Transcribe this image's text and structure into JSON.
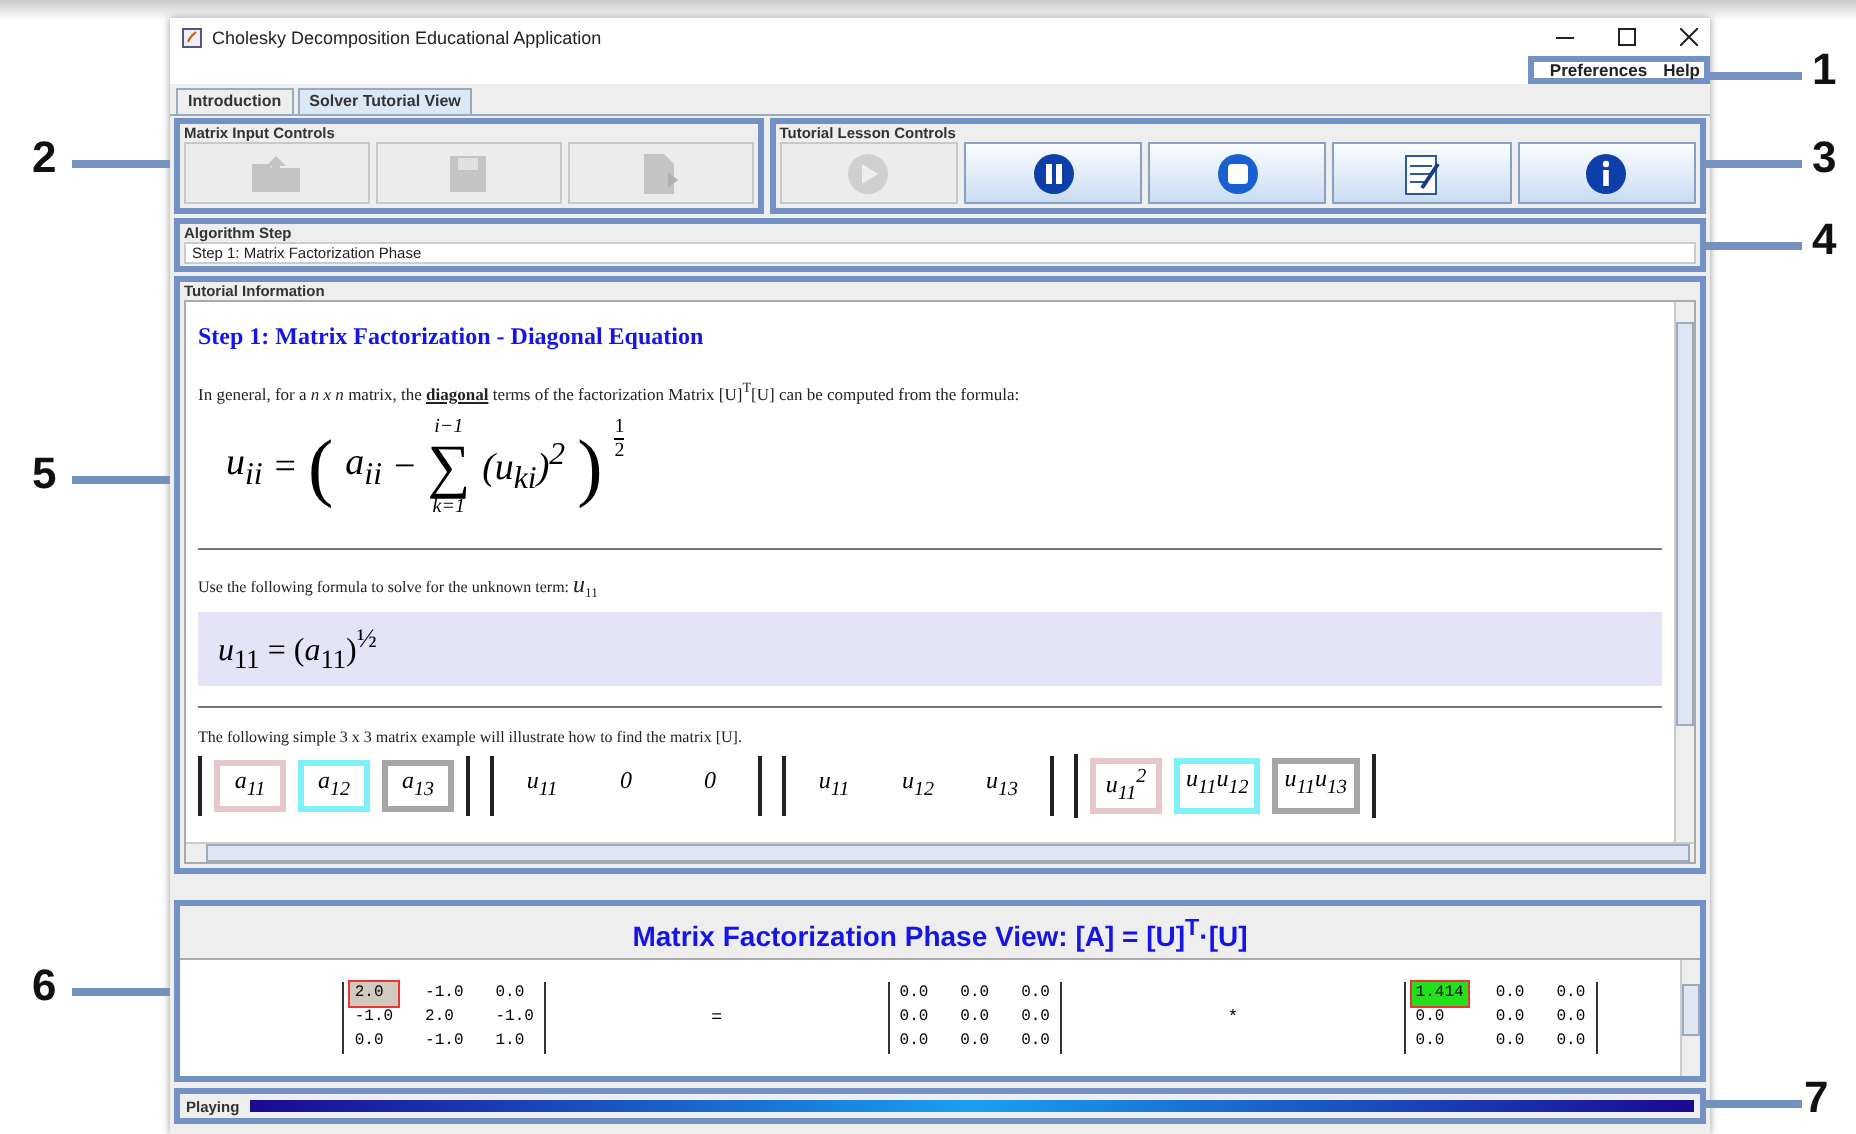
{
  "window": {
    "title": "Cholesky Decomposition Educational Application"
  },
  "menu": [
    {
      "label": "Preferences"
    },
    {
      "label": "Help"
    }
  ],
  "tabs": [
    {
      "label": "Introduction",
      "selected": false
    },
    {
      "label": "Solver Tutorial View",
      "selected": true
    }
  ],
  "matrix_input_controls": {
    "title": "Matrix Input Controls",
    "buttons": [
      {
        "kind": "open",
        "disabled": true
      },
      {
        "kind": "save",
        "disabled": true
      },
      {
        "kind": "export",
        "disabled": true
      }
    ]
  },
  "tutorial_lesson_controls": {
    "title": "Tutorial Lesson Controls",
    "buttons": [
      {
        "kind": "play",
        "disabled": true
      },
      {
        "kind": "pause",
        "disabled": false
      },
      {
        "kind": "stop",
        "disabled": false
      },
      {
        "kind": "notes",
        "disabled": false
      },
      {
        "kind": "info",
        "disabled": false
      }
    ]
  },
  "algorithm_step": {
    "title": "Algorithm Step",
    "value": "Step 1: Matrix Factorization Phase"
  },
  "tutorial": {
    "title": "Tutorial Information",
    "heading": "Step 1: Matrix Factorization - Diagonal Equation",
    "intro": "In general, for a *n x n* matrix, the **diagonal** terms of the factorization Matrix [U]$^{T}$[U] can be computed from the formula:",
    "formula": {
      "lhs": "u$_{ii}$",
      "eq": "=",
      "open": "(",
      "term": "a$_{ii}$",
      "minus": "−",
      "sum": "∑",
      "sum_upper": "i−1",
      "sum_lower": "k=1",
      "summand": "(u$_{ki}$)$^{2}$",
      "close": ")",
      "exp_num": "1",
      "exp_den": "2"
    },
    "prompt": "Use the following formula to solve for the unknown term: *u*$_{11}$",
    "formula2": "*u*$_{11}$ = (*a*$_{11}$)$^{½}$",
    "example": "The following simple 3 x 3 matrix example will illustrate how to find the matrix [U].",
    "example_matrices": [
      {
        "cells": [
          {
            "text": "a$_{11}$",
            "color": "#e6c8cc"
          },
          {
            "text": "a$_{12}$",
            "color": "#7ff0f8"
          },
          {
            "text": "a$_{13}$",
            "color": "#a6a6a6"
          }
        ]
      },
      {
        "cells": [
          {
            "text": "u$_{11}$"
          },
          {
            "text": "0"
          },
          {
            "text": "0"
          }
        ]
      },
      {
        "cells": [
          {
            "text": "u$_{11}$"
          },
          {
            "text": "u$_{12}$"
          },
          {
            "text": "u$_{13}$"
          }
        ]
      },
      {
        "cells": [
          {
            "text": "u$_{11}$$^{2}$",
            "color": "#e6c8cc"
          },
          {
            "text": "u$_{11}$u$_{12}$",
            "color": "#7ff0f8"
          },
          {
            "text": "u$_{11}$u$_{13}$",
            "color": "#a6a6a6"
          }
        ]
      }
    ]
  },
  "phase_view": {
    "title": "Matrix Factorization Phase View: [A] = [U]$^{T}$·[U]",
    "items": [
      {
        "kind": "matrix",
        "rows": [
          [
            {
              "text": "2.0",
              "color": "#cfcabd"
            },
            "-1.0",
            "0.0"
          ],
          [
            "-1.0",
            "2.0",
            "-1.0"
          ],
          [
            "0.0",
            "-1.0",
            "1.0"
          ]
        ]
      },
      {
        "kind": "operator",
        "text": "="
      },
      {
        "kind": "matrix",
        "rows": [
          [
            "0.0",
            "0.0",
            "0.0"
          ],
          [
            "0.0",
            "0.0",
            "0.0"
          ],
          [
            "0.0",
            "0.0",
            "0.0"
          ]
        ]
      },
      {
        "kind": "operator",
        "text": "*"
      },
      {
        "kind": "matrix",
        "rows": [
          [
            {
              "text": "1.414",
              "color": "#22e01c"
            },
            "0.0",
            "0.0"
          ],
          [
            "0.0",
            "0.0",
            "0.0"
          ],
          [
            "0.0",
            "0.0",
            "0.0"
          ]
        ]
      }
    ]
  },
  "status": {
    "label": "Playing",
    "level": 1
  },
  "callouts": [
    {
      "label": "1"
    },
    {
      "label": "2"
    },
    {
      "label": "3"
    },
    {
      "label": "4"
    },
    {
      "label": "5"
    },
    {
      "label": "6"
    },
    {
      "label": "7"
    }
  ]
}
